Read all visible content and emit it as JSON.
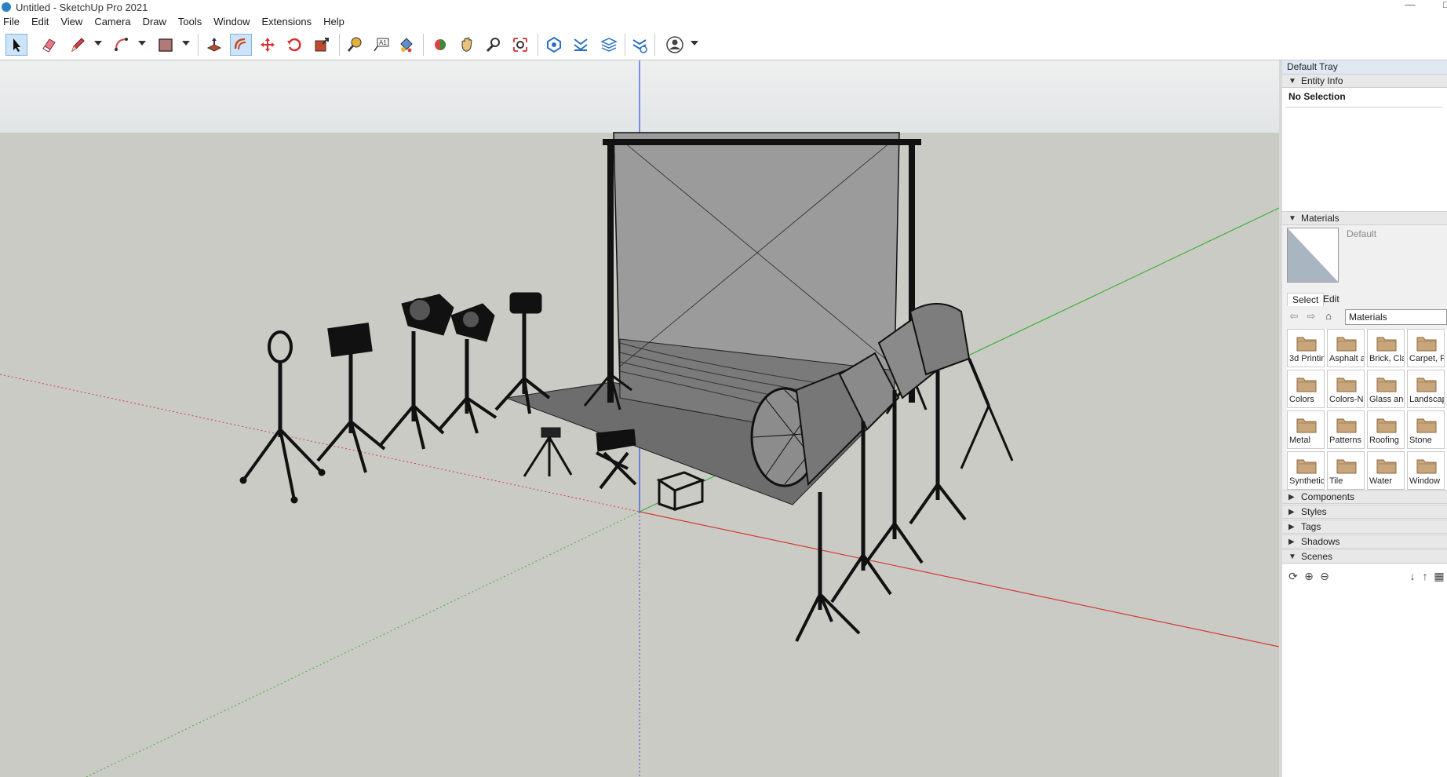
{
  "window": {
    "title": "Untitled - SketchUp Pro 2021",
    "minimize": "—",
    "restore": "□"
  },
  "menu": [
    "File",
    "Edit",
    "View",
    "Camera",
    "Draw",
    "Tools",
    "Window",
    "Extensions",
    "Help"
  ],
  "toolbar": {
    "tools": [
      "select",
      "eraser",
      "line",
      "arc",
      "rectangle",
      "push-pull",
      "offset",
      "move",
      "rotate",
      "scale",
      "tape-measure",
      "text",
      "paint-bucket",
      "orbit",
      "pan",
      "zoom",
      "zoom-extents",
      "3d-warehouse",
      "extension-warehouse",
      "layout",
      "extension-manager",
      "account"
    ],
    "active_tool": "offset"
  },
  "colors": {
    "sky": "#e9ecec",
    "ground": "#cbcbc5",
    "axis_red": "#d23c3c",
    "axis_green": "#3ab33a",
    "axis_blue": "#2f4fe0",
    "backdrop": "#9b9b9b",
    "folder": "#c8a57a"
  },
  "tray": {
    "title": "Default Tray",
    "entity_info": {
      "header": "Entity Info",
      "value": "No Selection"
    },
    "materials": {
      "header": "Materials",
      "current": "Default",
      "tabs": [
        "Select",
        "Edit"
      ],
      "collection": "Materials",
      "items": [
        "3d Printin",
        "Asphalt a",
        "Brick, Cla",
        "Carpet, F",
        "Colors",
        "Colors-N",
        "Glass and",
        "Landscap",
        "Metal",
        "Patterns",
        "Roofing",
        "Stone",
        "Synthetic",
        "Tile",
        "Water",
        "Window"
      ]
    },
    "collapsed_panels": [
      "Components",
      "Styles",
      "Tags",
      "Shadows"
    ],
    "scenes": {
      "header": "Scenes"
    }
  }
}
